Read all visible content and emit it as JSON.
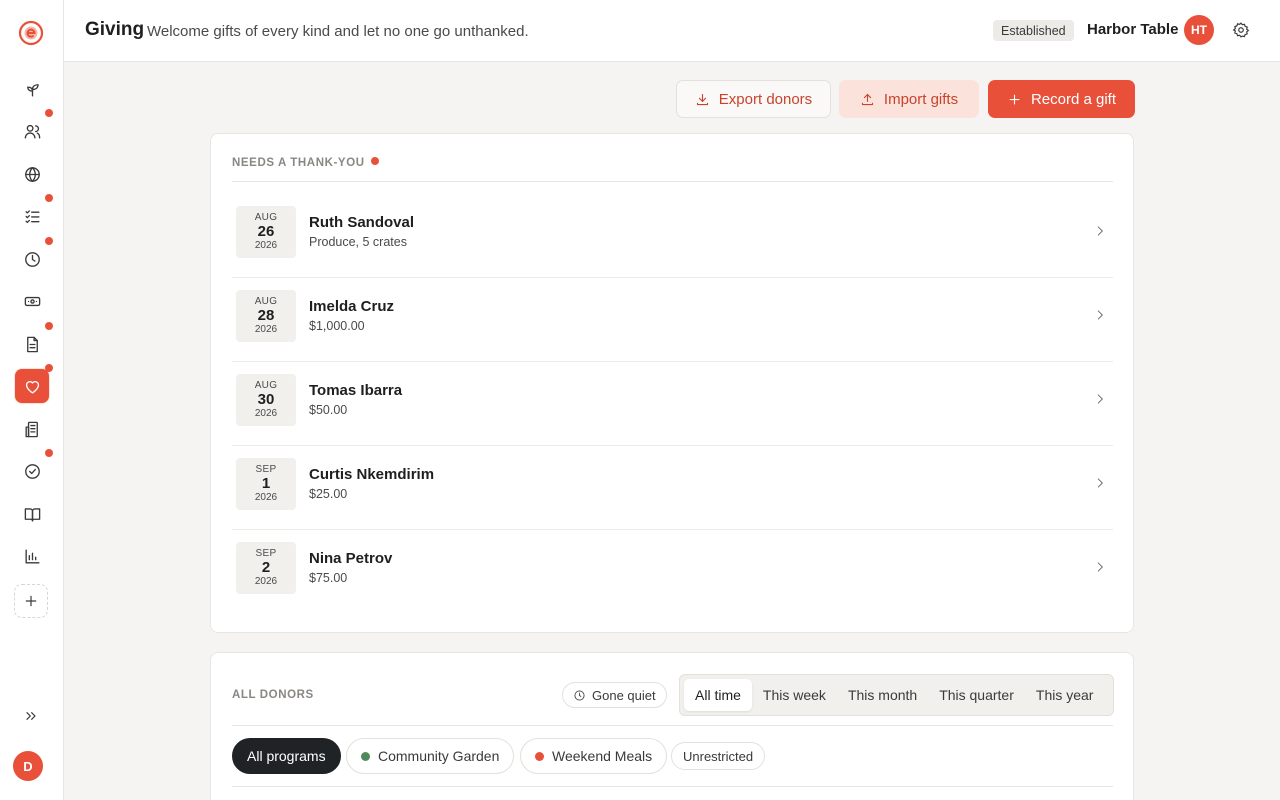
{
  "header": {
    "title": "Giving",
    "subtitle": "Welcome gifts of every kind and let no one go unthanked.",
    "badge": "Established",
    "org_name": "Harbor Table",
    "org_initials": "HT"
  },
  "sidebar": {
    "user_initial": "D",
    "items": [
      {
        "icon": "sprout-icon",
        "dot": false
      },
      {
        "icon": "users-icon",
        "dot": true
      },
      {
        "icon": "globe-icon",
        "dot": false
      },
      {
        "icon": "checklist-icon",
        "dot": true
      },
      {
        "icon": "clock-icon",
        "dot": true
      },
      {
        "icon": "cash-icon",
        "dot": false
      },
      {
        "icon": "document-icon",
        "dot": true
      },
      {
        "icon": "heart-icon",
        "dot": true,
        "active": true
      },
      {
        "icon": "building-icon",
        "dot": false
      },
      {
        "icon": "check-circle-icon",
        "dot": true
      },
      {
        "icon": "book-icon",
        "dot": false
      },
      {
        "icon": "bar-chart-icon",
        "dot": false
      }
    ]
  },
  "actions": {
    "export_label": "Export donors",
    "import_label": "Import gifts",
    "record_label": "Record a gift"
  },
  "thank_you": {
    "label": "NEEDS A THANK-YOU",
    "gifts": [
      {
        "month": "AUG",
        "day": "26",
        "year": "2026",
        "donor": "Ruth Sandoval",
        "desc": "Produce, 5 crates"
      },
      {
        "month": "AUG",
        "day": "28",
        "year": "2026",
        "donor": "Imelda Cruz",
        "desc": "$1,000.00"
      },
      {
        "month": "AUG",
        "day": "30",
        "year": "2026",
        "donor": "Tomas Ibarra",
        "desc": "$50.00"
      },
      {
        "month": "SEP",
        "day": "1",
        "year": "2026",
        "donor": "Curtis Nkemdirim",
        "desc": "$25.00"
      },
      {
        "month": "SEP",
        "day": "2",
        "year": "2026",
        "donor": "Nina Petrov",
        "desc": "$75.00"
      }
    ]
  },
  "all_donors": {
    "label": "ALL DONORS",
    "gone_quiet": "Gone quiet",
    "periods": [
      "All time",
      "This week",
      "This month",
      "This quarter",
      "This year"
    ],
    "active_period": "All time",
    "programs": [
      {
        "label": "All programs",
        "color": ""
      },
      {
        "label": "Community Garden",
        "color": "#4f8a5b"
      },
      {
        "label": "Weekend Meals",
        "color": "#e8503a"
      },
      {
        "label": "Unrestricted",
        "color": ""
      }
    ]
  },
  "colors": {
    "accent": "#e8503a",
    "accent_soft": "#fbe3dc",
    "dark_chip": "#1f2326"
  }
}
